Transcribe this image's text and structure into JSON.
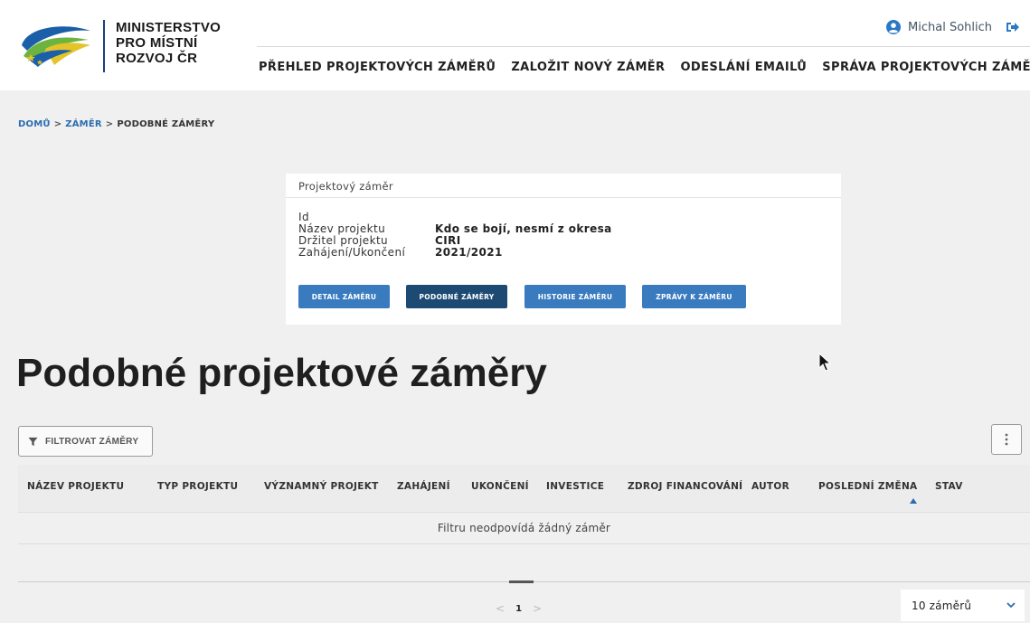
{
  "header": {
    "ministry_lines": [
      "MINISTERSTVO",
      "PRO MÍSTNÍ",
      "ROZVOJ ČR"
    ],
    "user_name": "Michal Sohlich",
    "user_icon": "user-circle-icon",
    "logout_icon": "logout-arrow-icon",
    "nav": [
      "PŘEHLED PROJEKTOVÝCH ZÁMĚRŮ",
      "ZALOŽIT NOVÝ ZÁMĚR",
      "ODESLÁNÍ EMAILŮ",
      "SPRÁVA PROJEKTOVÝCH ZÁMĚRŮ"
    ]
  },
  "breadcrumb": {
    "home": "DOMŮ",
    "zamer": "ZÁMĚR",
    "current": "PODOBNÉ ZÁMĚRY",
    "separator": ">"
  },
  "card": {
    "title": "Projektový záměr",
    "rows": [
      {
        "label": "Id",
        "value": ""
      },
      {
        "label": "Název projektu",
        "value": "Kdo se bojí, nesmí z okresa"
      },
      {
        "label": "Držitel projektu",
        "value": "CIRI"
      },
      {
        "label": "Zahájení/Ukončení",
        "value": "2021/2021"
      }
    ],
    "buttons": [
      "DETAIL ZÁMĚRU",
      "PODOBNÉ ZÁMĚRY",
      "HISTORIE ZÁMĚRU",
      "ZPRÁVY K ZÁMĚRU"
    ]
  },
  "page_title": "Podobné projektové záměry",
  "filter_label": "FILTROVAT ZÁMĚRY",
  "table": {
    "columns": [
      "NÁZEV PROJEKTU",
      "TYP PROJEKTU",
      "VÝZNAMNÝ PROJEKT",
      "ZAHÁJENÍ",
      "UKONČENÍ",
      "INVESTICE",
      "ZDROJ FINANCOVÁNÍ",
      "AUTOR",
      "POSLEDNÍ ZMĚNA",
      "STAV"
    ],
    "sorted_column": "POSLEDNÍ ZMĚNA",
    "empty_message": "Filtru neodpovídá žádný záměr"
  },
  "pagination": {
    "prev": "<",
    "page": "1",
    "next": ">"
  },
  "per_page": "10 záměrů",
  "colors": {
    "primary_button": "#3a7bc0",
    "active_button": "#1d4a73",
    "link": "#2b6cb0",
    "background": "#f0f0f0"
  }
}
